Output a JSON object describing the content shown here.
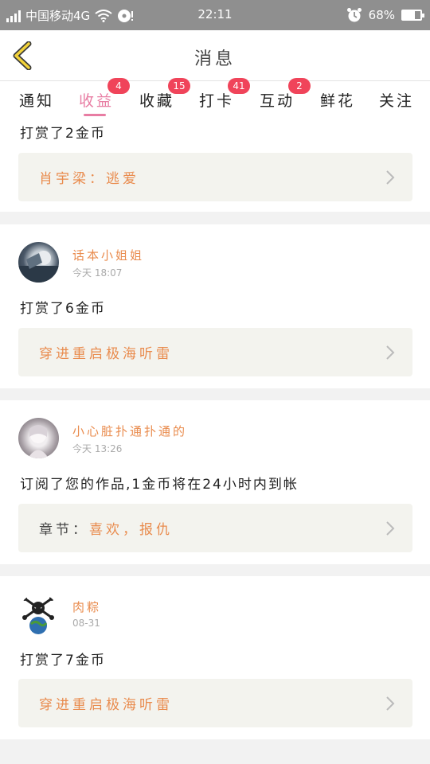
{
  "status_bar": {
    "carrier": "中国移动4G",
    "time": "22:11",
    "battery": "68%",
    "battery_level": 0.68
  },
  "header": {
    "title": "消息"
  },
  "tabs": [
    {
      "label": "通知",
      "badge": ""
    },
    {
      "label": "收益",
      "badge": "4"
    },
    {
      "label": "收藏",
      "badge": "15"
    },
    {
      "label": "打卡",
      "badge": "41"
    },
    {
      "label": "互动",
      "badge": "2"
    },
    {
      "label": "鲜花",
      "badge": ""
    },
    {
      "label": "关注",
      "badge": ""
    }
  ],
  "items": [
    {
      "message": "打赏了2金币",
      "ref_prefix": "",
      "ref_text": "肖宇梁：逃爱"
    },
    {
      "user": "话本小姐姐",
      "time": "今天 18:07",
      "message": "打赏了6金币",
      "ref_prefix": "",
      "ref_text": "穿进重启极海听雷"
    },
    {
      "user": "小心脏扑通扑通的",
      "time": "今天 13:26",
      "message": "订阅了您的作品,1金币将在24小时内到帐",
      "ref_prefix": "章节：",
      "ref_text": "喜欢，报仇"
    },
    {
      "user": "肉粽",
      "time": "08-31",
      "message": "打赏了7金币",
      "ref_prefix": "",
      "ref_text": "穿进重启极海听雷"
    }
  ]
}
